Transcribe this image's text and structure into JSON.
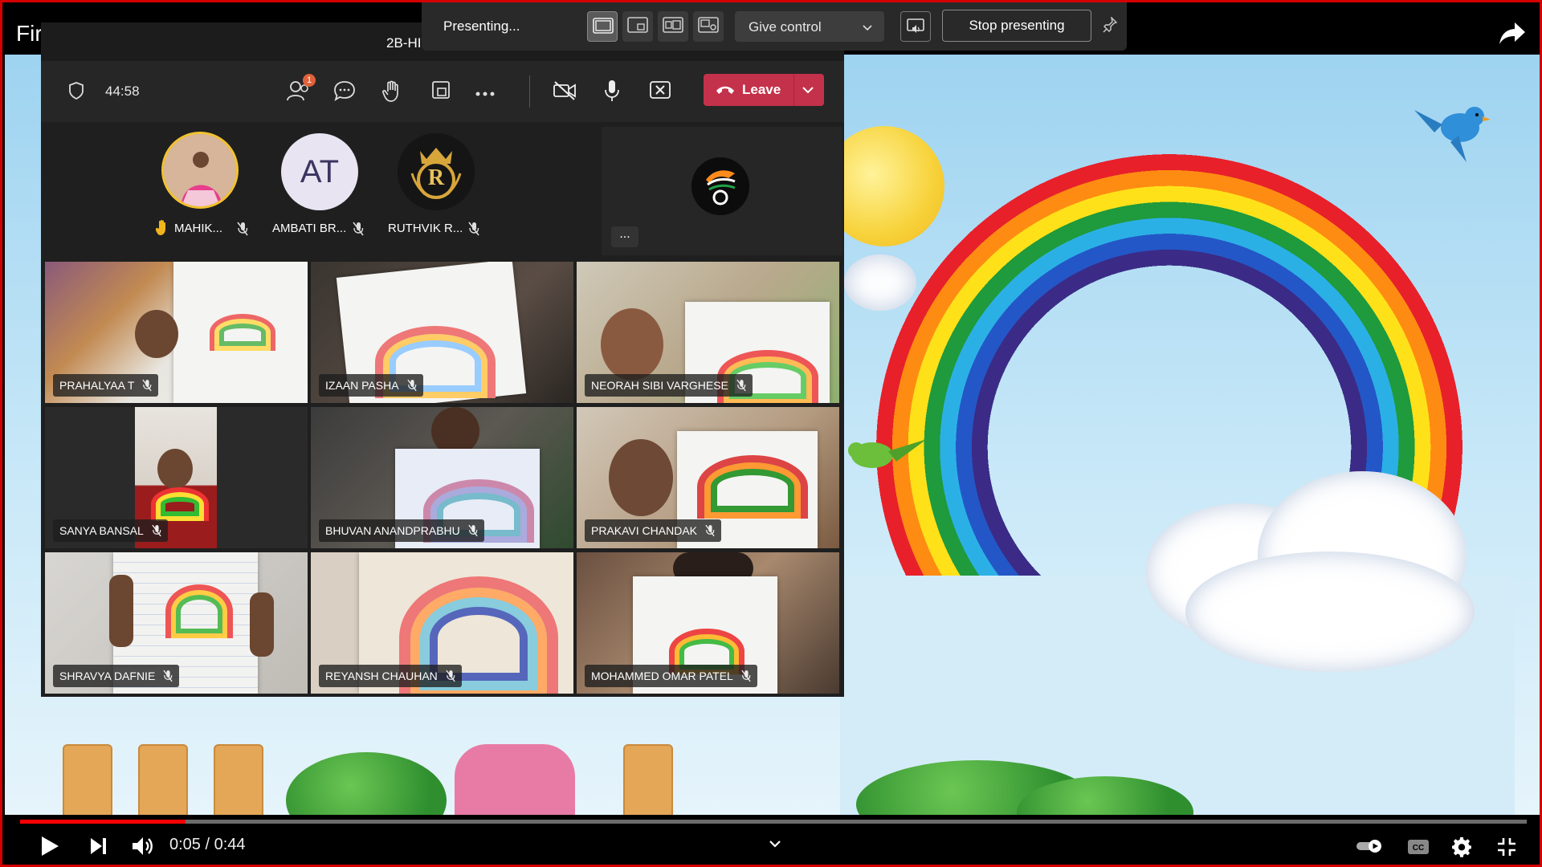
{
  "player": {
    "title": "Fir",
    "time_current": "0:05",
    "time_separator": "/",
    "time_total": "0:44",
    "progress_fraction": 0.11
  },
  "present_bar": {
    "status": "Presenting...",
    "give_control": "Give control",
    "stop": "Stop presenting"
  },
  "meeting": {
    "name": "2B-HI",
    "timer": "44:58",
    "participants_badge": "1",
    "leave_label": "Leave",
    "more_label": "...",
    "colors": {
      "leave": "#c4314b",
      "badge": "#e0613a",
      "hand": "#f2b41c"
    }
  },
  "strip_participants": [
    {
      "name": "MAHIK...",
      "hand_raised": true
    },
    {
      "name": "AMBATI BR...",
      "initials": "AT"
    },
    {
      "name": "RUTHVIK R...",
      "initials": "R"
    }
  ],
  "tiles": [
    {
      "name": "PRAHALYAA T"
    },
    {
      "name": "IZAAN PASHA"
    },
    {
      "name": "NEORAH SIBI VARGHESE"
    },
    {
      "name": "SANYA BANSAL"
    },
    {
      "name": "BHUVAN ANANDPRABHU"
    },
    {
      "name": "PRAKAVI CHANDAK"
    },
    {
      "name": "SHRAVYA DAFNIE"
    },
    {
      "name": "REYANSH CHAUHAN"
    },
    {
      "name": "MOHAMMED OMAR PATEL"
    }
  ]
}
